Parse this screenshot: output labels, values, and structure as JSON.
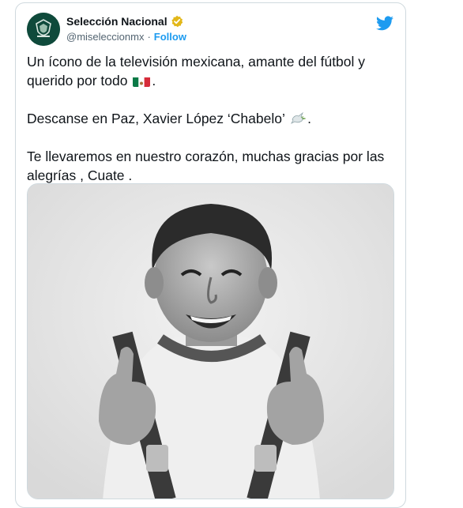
{
  "account": {
    "display_name": "Selección Nacional",
    "handle": "@miseleccionmx",
    "separator": "·",
    "follow_label": "Follow",
    "verified_icon": "verified-badge-icon",
    "platform_icon": "twitter-bird-icon"
  },
  "tweet": {
    "line1": "Un ícono de la televisión mexicana, amante del fútbol y querido por todo",
    "line1_end": ".",
    "line2": "Descanse en Paz, Xavier López ‘Chabelo’",
    "line2_end": ".",
    "line3": "Te llevaremos en nuestro corazón, muchas gracias por las alegrías , Cuate ."
  },
  "colors": {
    "brand_blue": "#1d9bf0",
    "avatar_green": "#0f4a3b",
    "verified_gold": "#e2b719",
    "text": "#0f1419",
    "muted": "#536471"
  },
  "media": {
    "icon": "photo-grayscale"
  }
}
